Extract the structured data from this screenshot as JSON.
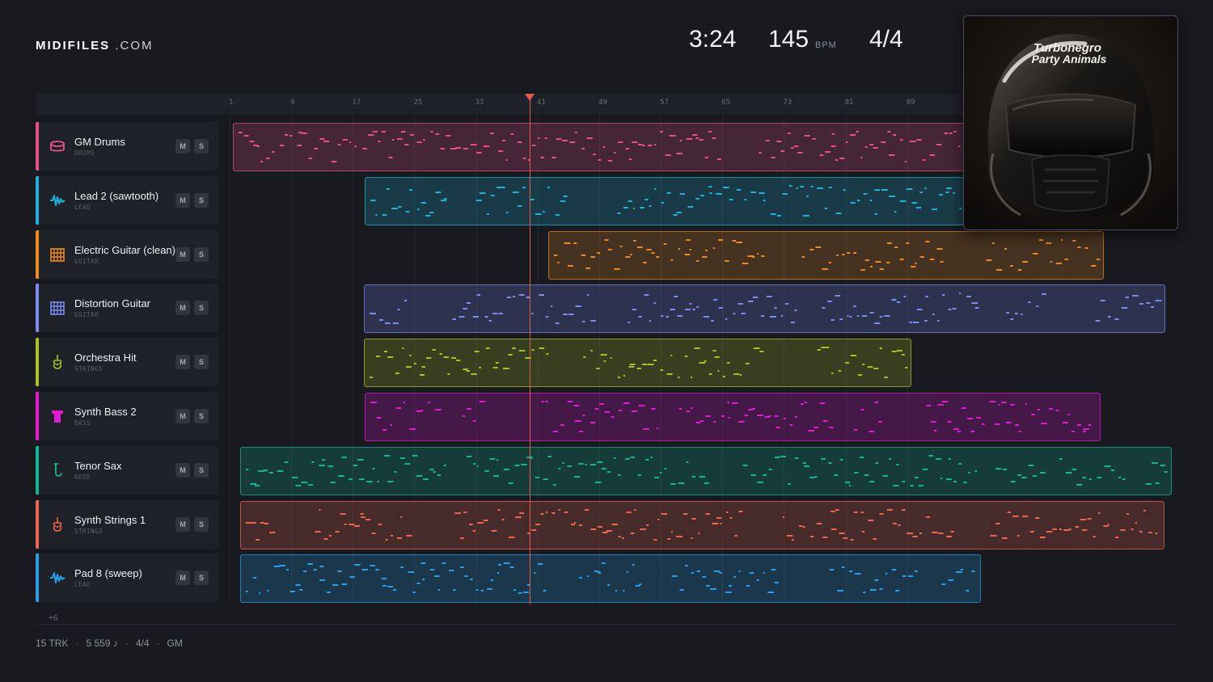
{
  "brand": {
    "bold": "MIDIFILES",
    "light": ".COM"
  },
  "header": {
    "time": "3:24",
    "tempo": "145",
    "tempo_unit": "BPM",
    "signature": "4/4"
  },
  "album": {
    "artist": "Turbonegro",
    "title": "Party Animals"
  },
  "ruler": {
    "labels": [
      "1",
      "9",
      "17",
      "25",
      "33",
      "41",
      "49",
      "57",
      "65",
      "73",
      "81",
      "89"
    ]
  },
  "playhead": {
    "bar": 40
  },
  "tracks": [
    {
      "name": "GM Drums",
      "category": "DRUMS",
      "color": "#e8508a",
      "icon": "drum-icon"
    },
    {
      "name": "Lead 2 (sawtooth)",
      "category": "LEAD",
      "color": "#21b0d8",
      "icon": "waveform-icon"
    },
    {
      "name": "Electric Guitar (clean)",
      "category": "GUITAR",
      "color": "#ef8a1f",
      "icon": "guitar-fretboard-icon"
    },
    {
      "name": "Distortion Guitar",
      "category": "GUITAR",
      "color": "#7b8df0",
      "icon": "guitar-fretboard-icon"
    },
    {
      "name": "Orchestra Hit",
      "category": "STRINGS",
      "color": "#a9c21f",
      "icon": "violin-icon"
    },
    {
      "name": "Synth Bass 2",
      "category": "BASS",
      "color": "#e319d4",
      "icon": "bass-icon"
    },
    {
      "name": "Tenor Sax",
      "category": "REED",
      "color": "#14b597",
      "icon": "saxophone-icon"
    },
    {
      "name": "Synth Strings 1",
      "category": "STRINGS",
      "color": "#f0654f",
      "icon": "violin-icon"
    },
    {
      "name": "Pad 8 (sweep)",
      "category": "LEAD",
      "color": "#2a9ee8",
      "icon": "waveform-icon"
    }
  ],
  "buttons": {
    "mute": "M",
    "solo": "S"
  },
  "more_tracks": "+6",
  "footer": {
    "tracks": "15 TRK",
    "notes": "5 559 ♪",
    "signature": "4/4",
    "standard": "GM"
  }
}
